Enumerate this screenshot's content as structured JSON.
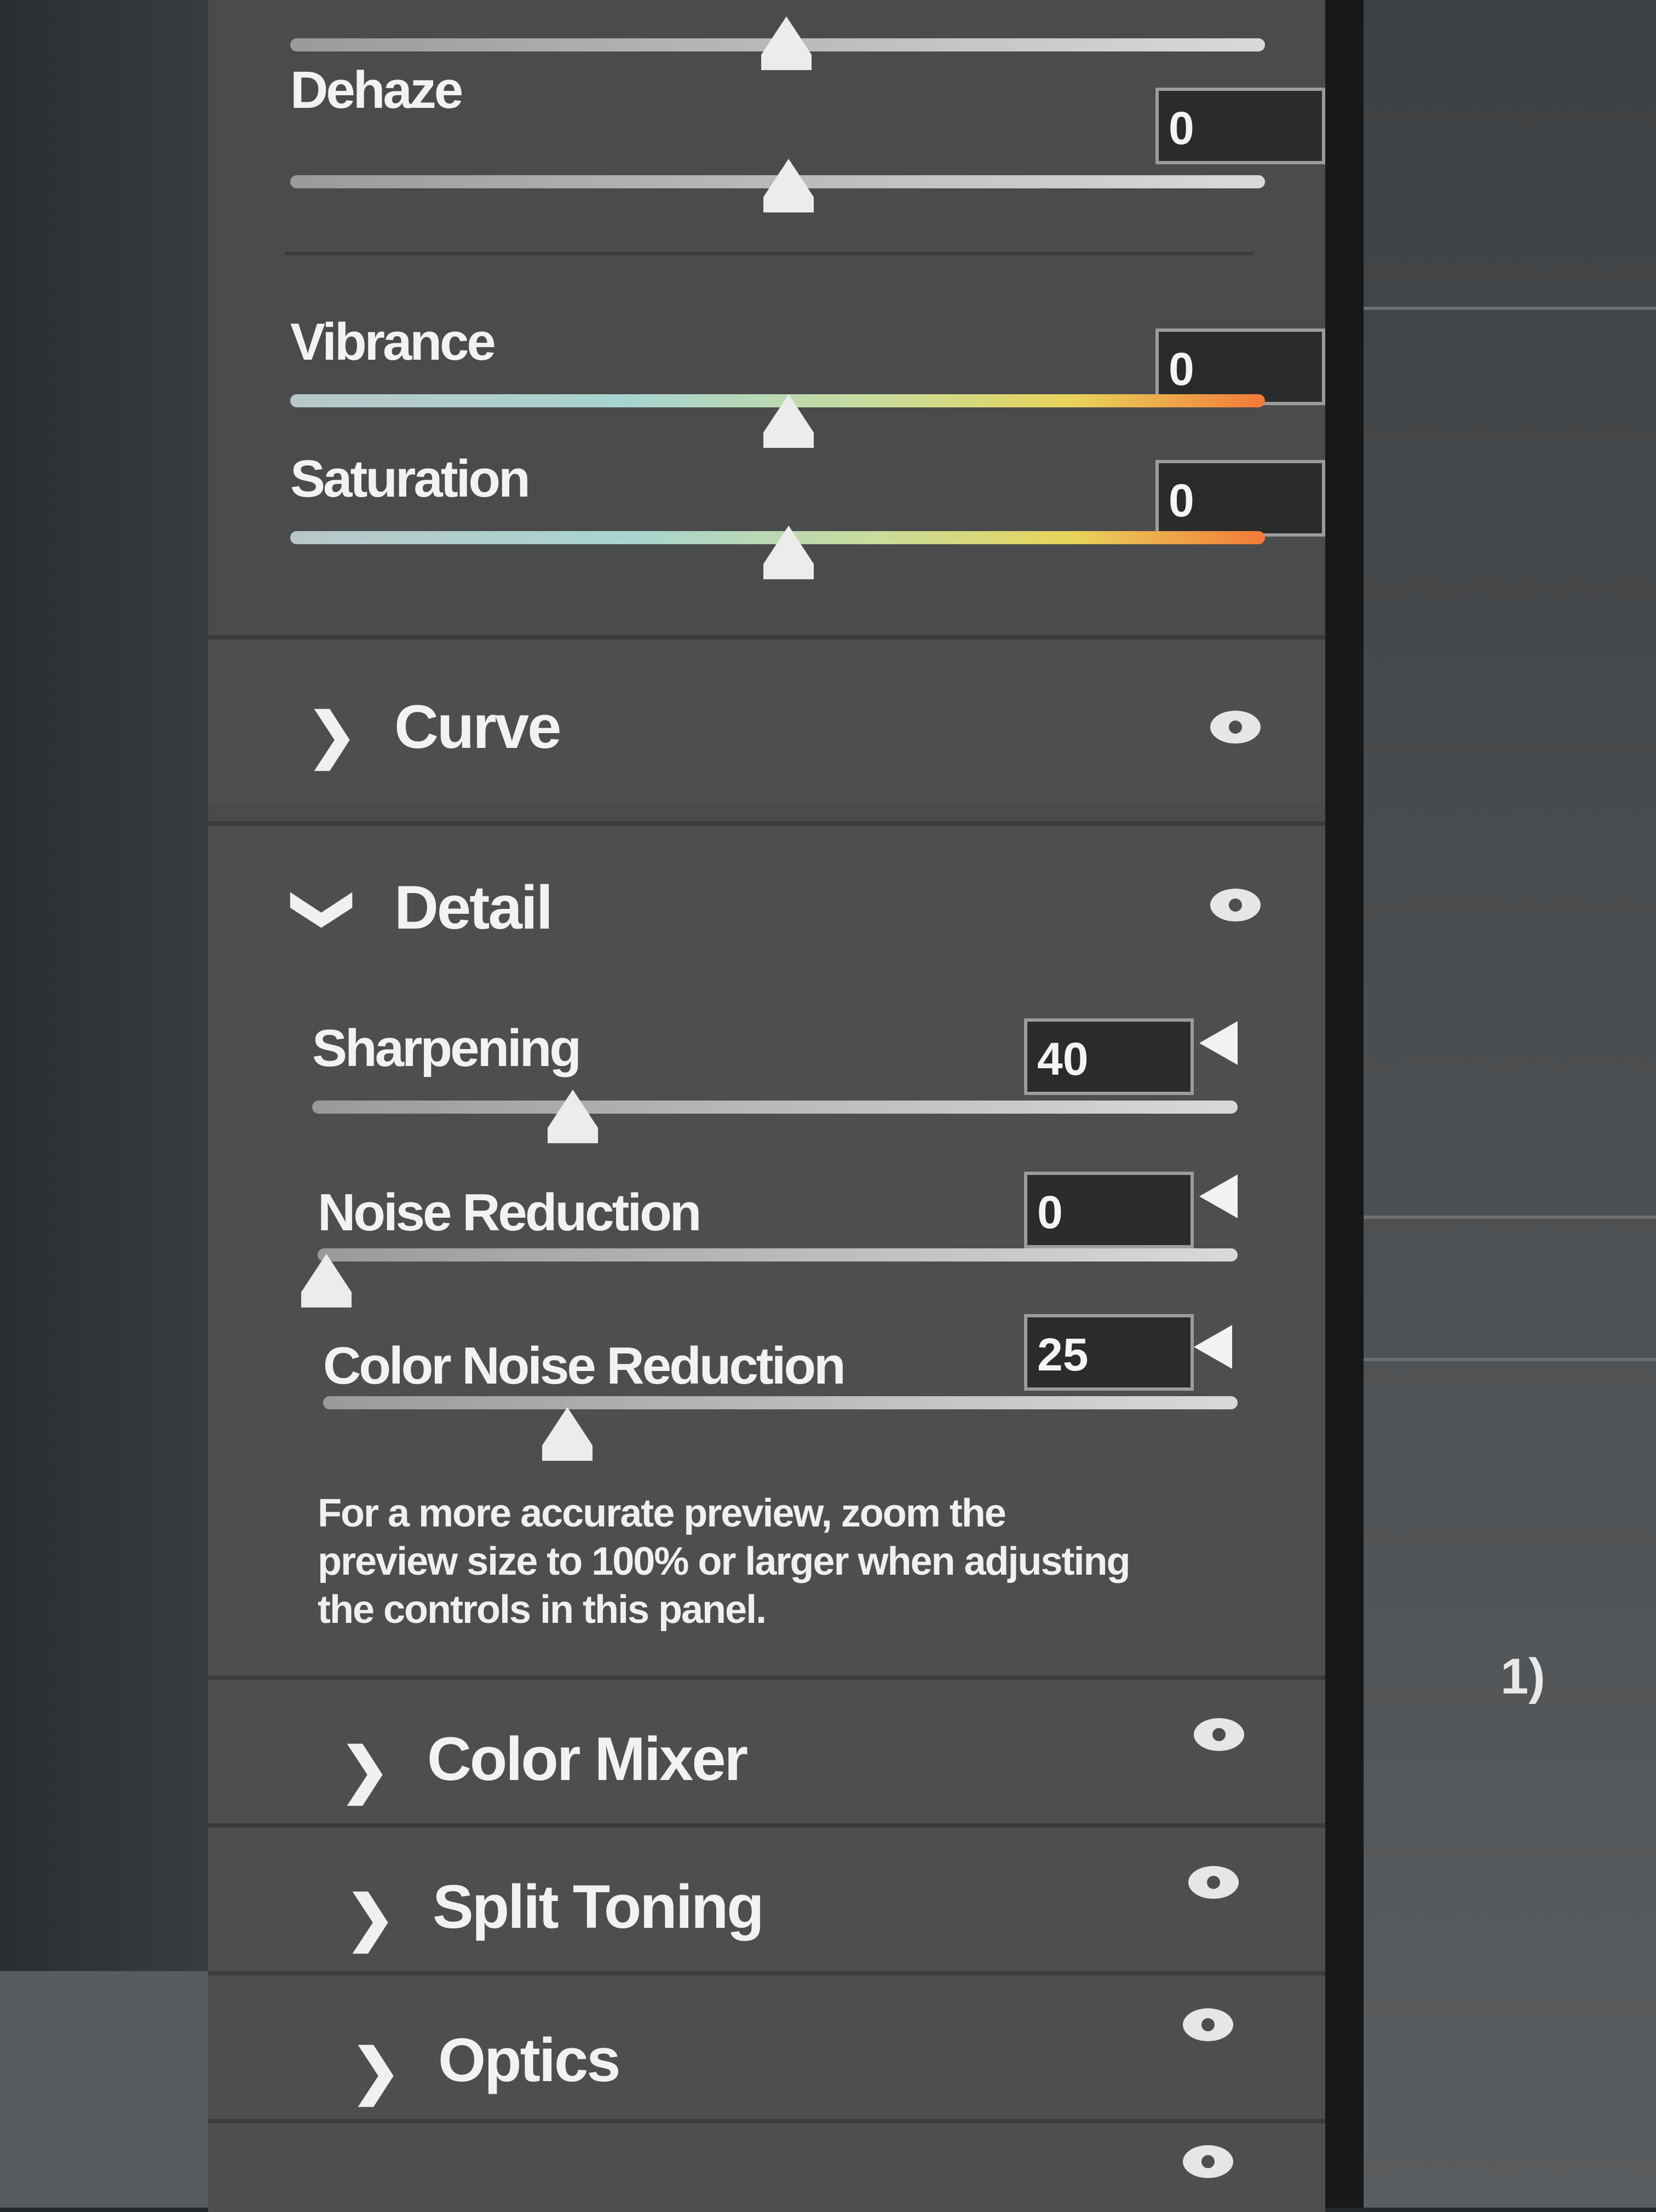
{
  "basic": {
    "dehaze": {
      "label": "Dehaze",
      "value": "0"
    },
    "vibrance": {
      "label": "Vibrance",
      "value": "0"
    },
    "saturation": {
      "label": "Saturation",
      "value": "0"
    }
  },
  "sections": {
    "curve": {
      "title": "Curve",
      "expanded": false
    },
    "detail": {
      "title": "Detail",
      "expanded": true
    },
    "color_mixer": {
      "title": "Color Mixer",
      "expanded": false
    },
    "split_toning": {
      "title": "Split Toning",
      "expanded": false
    },
    "optics": {
      "title": "Optics",
      "expanded": false
    }
  },
  "detail": {
    "sharpening": {
      "label": "Sharpening",
      "value": "40"
    },
    "noise_reduction": {
      "label": "Noise Reduction",
      "value": "0"
    },
    "color_noise_reduction": {
      "label": "Color Noise Reduction",
      "value": "25"
    },
    "hint": "For a more accurate preview, zoom the preview size to 100% or larger when adjusting the controls in this panel."
  },
  "icons": {
    "expand": "chevron-right-icon",
    "collapse": "chevron-down-icon",
    "visibility": "eye-icon",
    "reset": "triangle-left-icon"
  },
  "edge_label": "1)"
}
